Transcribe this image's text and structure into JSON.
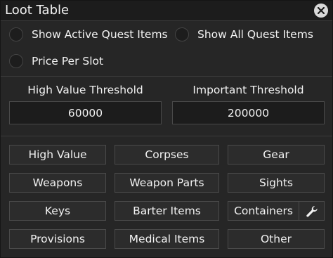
{
  "window": {
    "title": "Loot Table"
  },
  "options": {
    "show_active_quest_items": "Show Active Quest Items",
    "show_all_quest_items": "Show All Quest Items",
    "price_per_slot": "Price Per Slot"
  },
  "thresholds": {
    "high_value": {
      "label": "High Value Threshold",
      "value": "60000"
    },
    "important": {
      "label": "Important Threshold",
      "value": "200000"
    }
  },
  "categories": {
    "high_value": "High Value",
    "corpses": "Corpses",
    "gear": "Gear",
    "weapons": "Weapons",
    "weapon_parts": "Weapon Parts",
    "sights": "Sights",
    "keys": "Keys",
    "barter_items": "Barter Items",
    "containers": "Containers",
    "provisions": "Provisions",
    "medical_items": "Medical Items",
    "other": "Other"
  },
  "icons": {
    "close": "close-icon",
    "containers_settings": "wrench-icon"
  }
}
